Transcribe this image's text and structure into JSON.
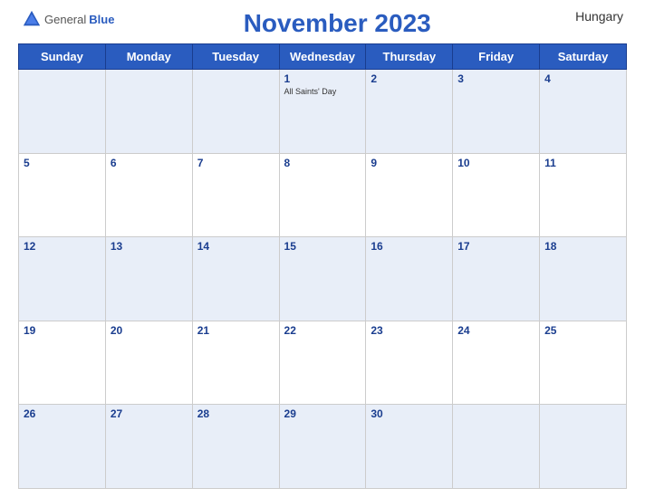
{
  "header": {
    "logo_general": "General",
    "logo_blue": "Blue",
    "title": "November 2023",
    "country": "Hungary"
  },
  "days_of_week": [
    "Sunday",
    "Monday",
    "Tuesday",
    "Wednesday",
    "Thursday",
    "Friday",
    "Saturday"
  ],
  "weeks": [
    [
      {
        "day": "",
        "event": ""
      },
      {
        "day": "",
        "event": ""
      },
      {
        "day": "",
        "event": ""
      },
      {
        "day": "1",
        "event": "All Saints' Day"
      },
      {
        "day": "2",
        "event": ""
      },
      {
        "day": "3",
        "event": ""
      },
      {
        "day": "4",
        "event": ""
      }
    ],
    [
      {
        "day": "5",
        "event": ""
      },
      {
        "day": "6",
        "event": ""
      },
      {
        "day": "7",
        "event": ""
      },
      {
        "day": "8",
        "event": ""
      },
      {
        "day": "9",
        "event": ""
      },
      {
        "day": "10",
        "event": ""
      },
      {
        "day": "11",
        "event": ""
      }
    ],
    [
      {
        "day": "12",
        "event": ""
      },
      {
        "day": "13",
        "event": ""
      },
      {
        "day": "14",
        "event": ""
      },
      {
        "day": "15",
        "event": ""
      },
      {
        "day": "16",
        "event": ""
      },
      {
        "day": "17",
        "event": ""
      },
      {
        "day": "18",
        "event": ""
      }
    ],
    [
      {
        "day": "19",
        "event": ""
      },
      {
        "day": "20",
        "event": ""
      },
      {
        "day": "21",
        "event": ""
      },
      {
        "day": "22",
        "event": ""
      },
      {
        "day": "23",
        "event": ""
      },
      {
        "day": "24",
        "event": ""
      },
      {
        "day": "25",
        "event": ""
      }
    ],
    [
      {
        "day": "26",
        "event": ""
      },
      {
        "day": "27",
        "event": ""
      },
      {
        "day": "28",
        "event": ""
      },
      {
        "day": "29",
        "event": ""
      },
      {
        "day": "30",
        "event": ""
      },
      {
        "day": "",
        "event": ""
      },
      {
        "day": "",
        "event": ""
      }
    ]
  ],
  "colors": {
    "header_bg": "#2a5cbf",
    "odd_row_bg": "#e8eef8",
    "even_row_bg": "#ffffff",
    "day_number_color": "#1a3d8f"
  }
}
